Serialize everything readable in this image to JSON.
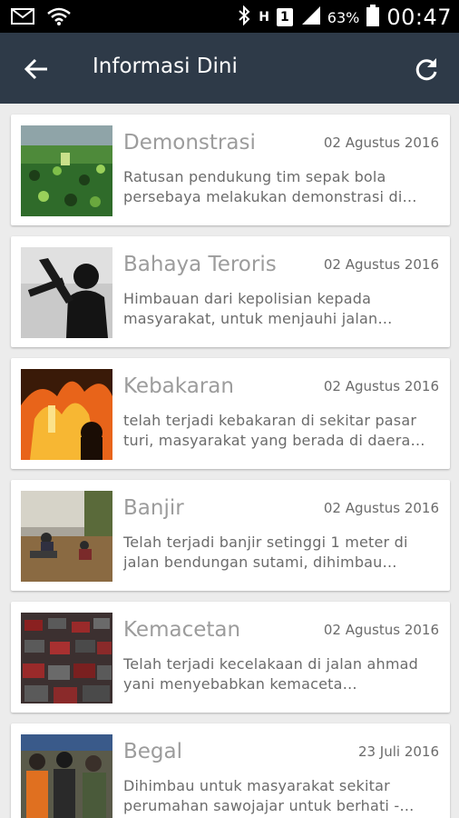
{
  "status_bar": {
    "network_box": "1",
    "network_letter": "H",
    "battery_percent": "63%",
    "time": "00:47"
  },
  "app_bar": {
    "title": "Informasi Dini"
  },
  "items": [
    {
      "title": "Demonstrasi",
      "date": "02 Agustus 2016",
      "desc": "Ratusan pendukung tim sepak bola persebaya melakukan demonstrasi di…"
    },
    {
      "title": "Bahaya Teroris",
      "date": "02 Agustus 2016",
      "desc": "Himbauan dari kepolisian kepada masyarakat, untuk menjauhi jalan…"
    },
    {
      "title": "Kebakaran",
      "date": "02 Agustus 2016",
      "desc": "telah terjadi kebakaran di sekitar pasar turi, masyarakat yang berada di daera…"
    },
    {
      "title": "Banjir",
      "date": "02 Agustus 2016",
      "desc": "Telah terjadi banjir setinggi 1 meter di jalan bendungan sutami, dihimbau…"
    },
    {
      "title": "Kemacetan",
      "date": "02 Agustus 2016",
      "desc": "Telah terjadi kecelakaan di jalan ahmad yani menyebabkan kemaceta…"
    },
    {
      "title": "Begal",
      "date": "23 Juli 2016",
      "desc": "Dihimbau untuk masyarakat sekitar perumahan sawojajar untuk berhati -…"
    }
  ]
}
